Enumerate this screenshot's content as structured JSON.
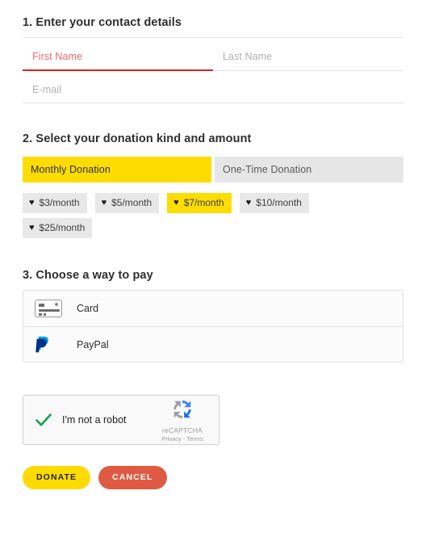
{
  "section1": {
    "title": "1. Enter your contact details",
    "fields": {
      "first_name": {
        "placeholder": "First Name",
        "value": ""
      },
      "last_name": {
        "placeholder": "Last Name",
        "value": ""
      },
      "email": {
        "placeholder": "E-mail",
        "value": ""
      }
    }
  },
  "section2": {
    "title": "2. Select your donation kind and amount",
    "kinds": [
      {
        "label": "Monthly Donation",
        "selected": true
      },
      {
        "label": "One-Time Donation",
        "selected": false
      }
    ],
    "amounts": [
      {
        "label": "$3/month",
        "icon": "heart-icon",
        "selected": false
      },
      {
        "label": "$5/month",
        "icon": "heart-icon",
        "selected": false
      },
      {
        "label": "$7/month",
        "icon": "heart-icon",
        "selected": true
      },
      {
        "label": "$10/month",
        "icon": "heart-icon",
        "selected": false
      },
      {
        "label": "$25/month",
        "icon": "heart-icon",
        "selected": false
      }
    ],
    "heart_glyph": "♥"
  },
  "section3": {
    "title": "3. Choose a way to pay",
    "methods": [
      {
        "label": "Card",
        "icon": "credit-card-icon"
      },
      {
        "label": "PayPal",
        "icon": "paypal-icon"
      }
    ]
  },
  "recaptcha": {
    "label": "I'm not a robot",
    "brand": "reCAPTCHA",
    "links": "Privacy - Terms",
    "checked": true
  },
  "actions": {
    "donate_label": "DONATE",
    "cancel_label": "CANCEL"
  },
  "colors": {
    "accent_yellow": "#fddd00",
    "error_red": "#e22020",
    "cancel_red": "#e05a43",
    "chip_gray": "#e8e8e8",
    "paypal_dark": "#003087",
    "paypal_light": "#009cde",
    "check_green": "#12a150"
  }
}
